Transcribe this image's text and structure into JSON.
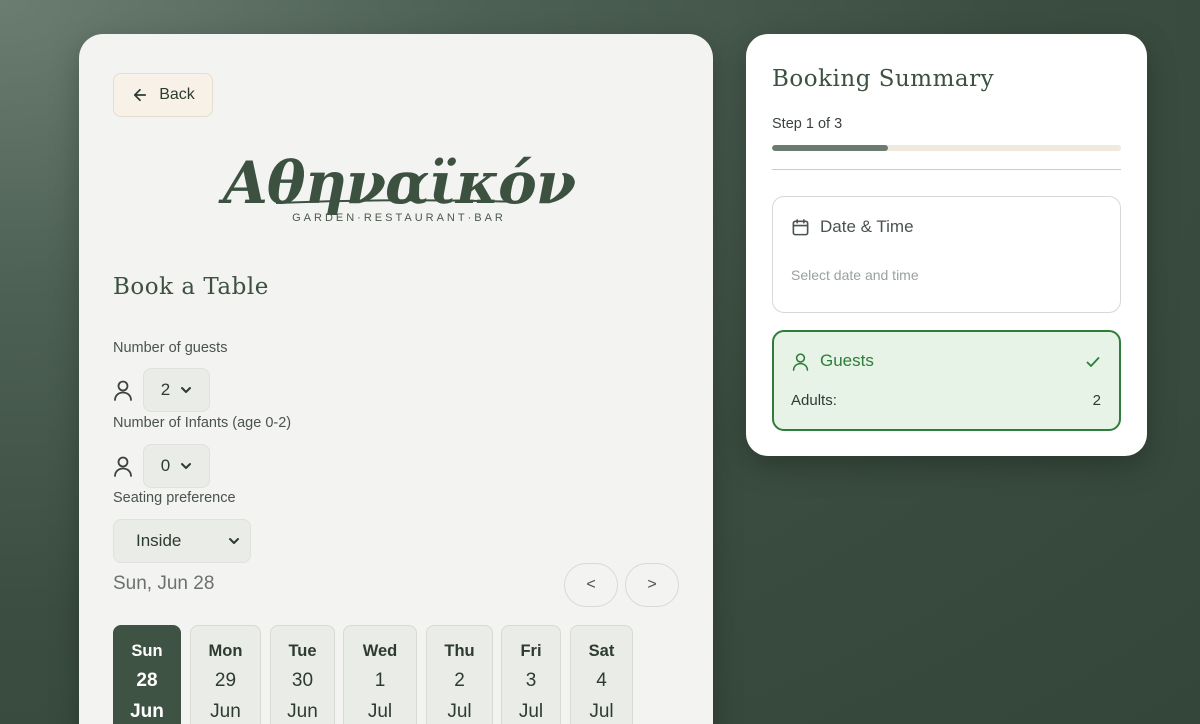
{
  "booking": {
    "back_label": "Back",
    "logo_text": "Αθηναϊκόν",
    "logo_subtitle": "GARDEN·RESTAURANT·BAR",
    "title": "Book a Table",
    "guests_label": "Number of guests",
    "guests_value": "2",
    "infants_label": "Number of Infants (age 0-2)",
    "infants_value": "0",
    "seating_label": "Seating preference",
    "seating_value": "Inside",
    "selected_date": "Sun, Jun 28",
    "prev_label": "<",
    "next_label": ">",
    "days": [
      {
        "dow": "Sun",
        "num": "28",
        "mon": "Jun",
        "selected": true
      },
      {
        "dow": "Mon",
        "num": "29",
        "mon": "Jun",
        "selected": false
      },
      {
        "dow": "Tue",
        "num": "30",
        "mon": "Jun",
        "selected": false
      },
      {
        "dow": "Wed",
        "num": "1",
        "mon": "Jul",
        "selected": false
      },
      {
        "dow": "Thu",
        "num": "2",
        "mon": "Jul",
        "selected": false
      },
      {
        "dow": "Fri",
        "num": "3",
        "mon": "Jul",
        "selected": false
      },
      {
        "dow": "Sat",
        "num": "4",
        "mon": "Jul",
        "selected": false
      }
    ]
  },
  "summary": {
    "title": "Booking Summary",
    "step_text": "Step 1 of 3",
    "progress_fraction": 0.333,
    "date_time_label": "Date & Time",
    "date_time_hint": "Select date and time",
    "guests_label": "Guests",
    "adults_label": "Adults:",
    "adults_value": "2"
  },
  "colors": {
    "brand_green": "#3c5140",
    "accent_green": "#2e7d3a",
    "selected_day": "#3f5344"
  }
}
